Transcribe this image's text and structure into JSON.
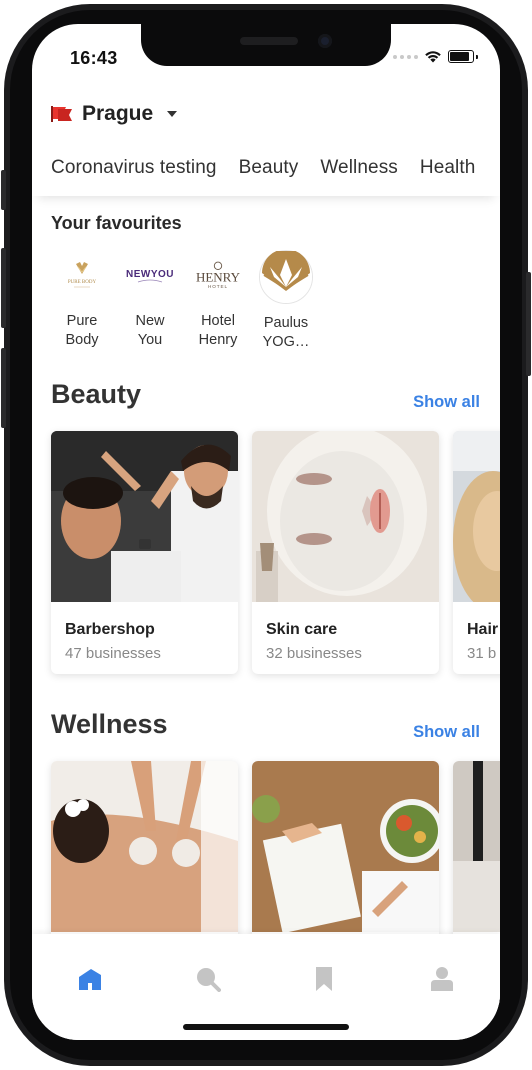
{
  "status_bar": {
    "time": "16:43"
  },
  "location": {
    "city": "Prague",
    "flag_color": "#e8342e"
  },
  "category_tabs": [
    "Coronavirus testing",
    "Beauty",
    "Wellness",
    "Health"
  ],
  "favourites": {
    "title": "Your favourites",
    "items": [
      {
        "name_line1": "Pure",
        "name_line2": "Body",
        "logo": "pure-body-logo"
      },
      {
        "name_line1": "New",
        "name_line2": "You",
        "logo": "newyou-logo"
      },
      {
        "name_line1": "Hotel",
        "name_line2": "Henry",
        "logo": "henry-hotel-logo"
      },
      {
        "name_line1": "Paulus",
        "name_line2": "YOG…",
        "logo": "paulus-yoga-logo"
      }
    ]
  },
  "beauty": {
    "title": "Beauty",
    "show_all": "Show all",
    "cards": [
      {
        "title": "Barbershop",
        "subtitle": "47 businesses"
      },
      {
        "title": "Skin care",
        "subtitle": "32 businesses"
      },
      {
        "title": "Hair",
        "subtitle": "31 b"
      }
    ]
  },
  "wellness": {
    "title": "Wellness",
    "show_all": "Show all"
  },
  "tab_bar": {
    "items": [
      "home-icon",
      "search-icon",
      "bookmark-icon",
      "profile-icon"
    ],
    "active_color": "#3b82e4",
    "inactive_color": "#c4c4c4"
  },
  "logo_text": {
    "pure_body": "PURE BODY",
    "newyou": "NEWYOU",
    "henry": "HENRY",
    "hotel": "HOTEL"
  }
}
